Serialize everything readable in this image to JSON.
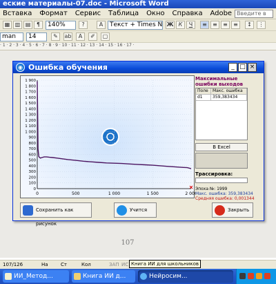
{
  "word": {
    "title": "еские материалы-07.doc - Microsoft Word",
    "menu": [
      "Вставка",
      "Формат",
      "Сервис",
      "Таблица",
      "Окно",
      "Справка",
      "Adobe PDF"
    ],
    "help_placeholder": "Введите в",
    "zoom": "140%",
    "style_field": "Текст + Times N",
    "font_field": "man",
    "size_field": "14",
    "ruler_marks": "· 1 · 2 · 3 · 4 · 5 · 6 · 7 · 8 · 9 · 10 · 11 · 12 · 13 · 14 · 15 · 16 · 17 ·",
    "page_number": "107"
  },
  "dialog": {
    "title": "Ошибка обучения",
    "side": {
      "max_title": "Максимальные ошибки выходов сети",
      "table_headers": [
        "Поле",
        "Макс. ошибка"
      ],
      "table_rows": [
        [
          "d1",
          "359,383434"
        ]
      ],
      "excel_button": "В Excel",
      "trace_label": "Трассировка:",
      "epoch": "Эпоха №: 1999",
      "max_error": "Макс. ошибка: 359,383434",
      "avg_error": "Средняя ошибка: 0,001344"
    },
    "buttons": {
      "save": "Сохранить как рисунок",
      "learn": "Учится",
      "close": "Закрыть"
    }
  },
  "chart_data": {
    "type": "line",
    "xlim": [
      0,
      2000
    ],
    "ylim": [
      0,
      1900
    ],
    "x_ticks": [
      "0",
      "500",
      "1 000",
      "1 500",
      "2 000"
    ],
    "y_ticks": [
      "0",
      "100",
      "200",
      "300",
      "400",
      "500",
      "600",
      "700",
      "800",
      "900",
      "1 000",
      "1 100",
      "1 200",
      "1 300",
      "1 400",
      "1 500",
      "1 600",
      "1 700",
      "1 800",
      "1 900"
    ],
    "series": [
      {
        "color": "#4b1460",
        "x": [
          0,
          5,
          10,
          20,
          40,
          60,
          90,
          120,
          160,
          200,
          260,
          300,
          400,
          500,
          600,
          700,
          800,
          900,
          1000,
          1100,
          1200,
          1300,
          1400,
          1500,
          1600,
          1700,
          1800,
          1900,
          1950,
          2000
        ],
        "y": [
          1880,
          1300,
          700,
          560,
          535,
          545,
          555,
          555,
          550,
          545,
          535,
          528,
          510,
          495,
          480,
          470,
          460,
          450,
          445,
          440,
          432,
          425,
          418,
          410,
          400,
          390,
          380,
          372,
          368,
          350
        ]
      }
    ],
    "grid": true
  },
  "status": {
    "page": "107/126",
    "at": "На",
    "line": "Ст",
    "col": "Кол",
    "rec": "ЗАП",
    "ispr": "ИС",
    "tooltip": "Книга ИИ для школьников"
  },
  "taskbar": {
    "tasks": [
      "ИИ_Метод...",
      "Книга ИИ д...",
      "Нейросим..."
    ],
    "active_index": 2
  }
}
